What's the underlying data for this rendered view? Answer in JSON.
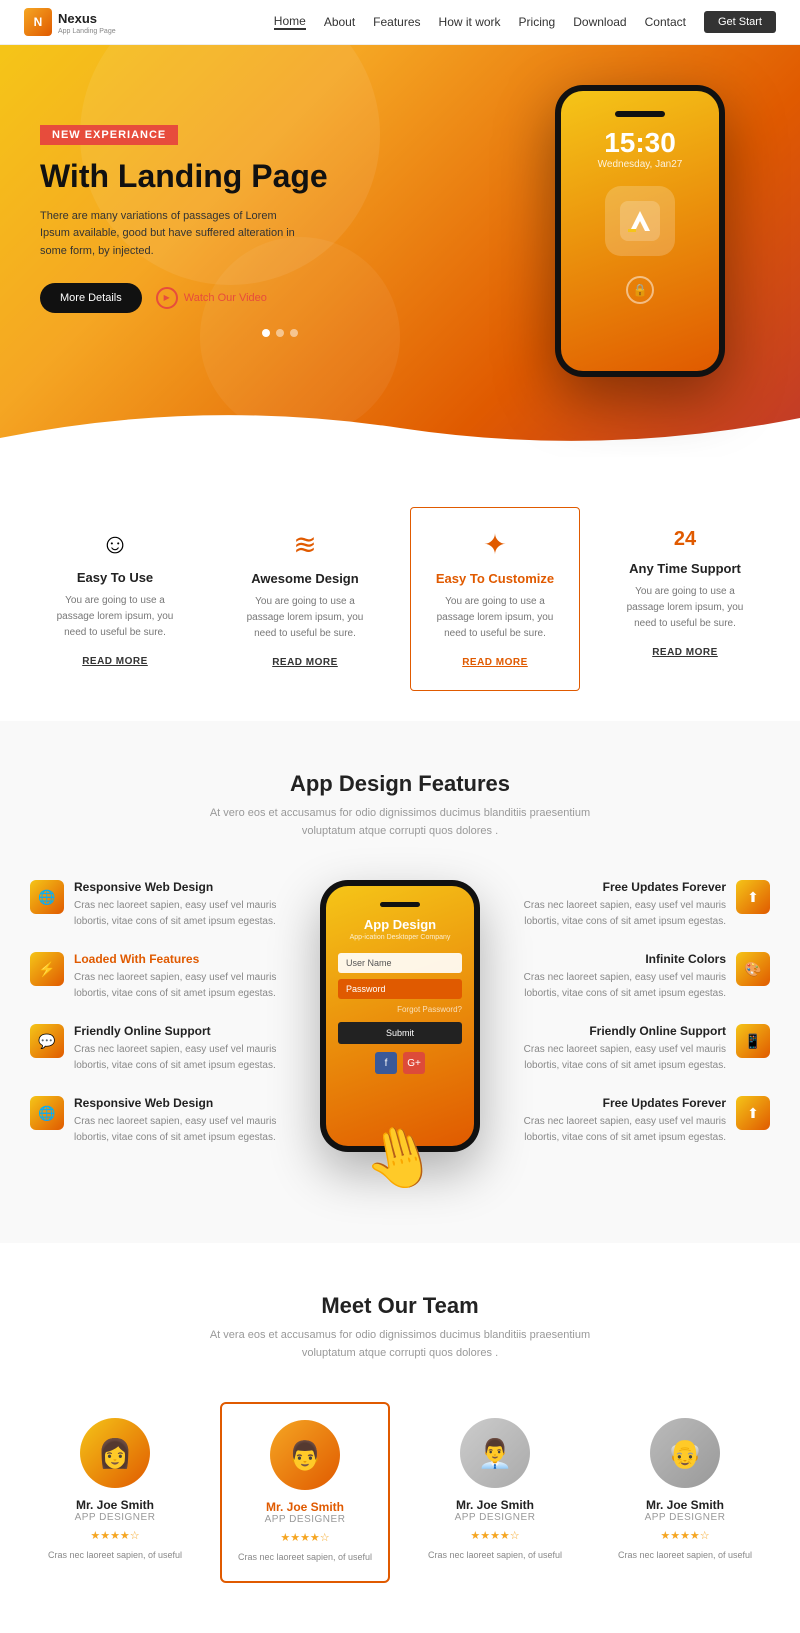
{
  "nav": {
    "logo": "Nexus",
    "logo_sub": "App Landing Page",
    "links": [
      "Home",
      "About",
      "Features",
      "How it work",
      "Pricing",
      "Download",
      "Contact"
    ],
    "active_link": "Home",
    "cta": "Get Start"
  },
  "hero": {
    "badge": "NEW EXPERIANCE",
    "title": "With Landing Page",
    "desc": "There are many variations of passages of Lorem Ipsum available, good but have suffered alteration in some form, by injected.",
    "btn_main": "More Details",
    "btn_video": "Watch Our Video",
    "phone_time": "15:30",
    "phone_date": "Wednesday, Jan27",
    "dots": [
      1,
      2,
      3
    ]
  },
  "features": {
    "title_section": "",
    "items": [
      {
        "icon": "☺",
        "title": "Easy To Use",
        "desc": "You are going to use a passage lorem ipsum, you need to useful be sure.",
        "link": "READ MORE",
        "active": false
      },
      {
        "icon": "≋",
        "title": "Awesome Design",
        "desc": "You are going to use a passage lorem ipsum, you need to useful be sure.",
        "link": "READ MORE",
        "active": false
      },
      {
        "icon": "✦",
        "title": "Easy To Customize",
        "desc": "You are going to use a passage lorem ipsum, you need to useful be sure.",
        "link": "READ MORE",
        "active": true
      },
      {
        "icon": "24",
        "title": "Any Time Support",
        "desc": "You are going to use a passage lorem ipsum, you need to useful be sure.",
        "link": "READ MORE",
        "active": false
      }
    ]
  },
  "app_features": {
    "title": "App Design Features",
    "subtitle": "At vero eos et accusamus for odio dignissimos ducimus blanditiis praesentium voluptatum atque corrupti quos dolores .",
    "left_items": [
      {
        "icon": "🌐",
        "title": "Responsive Web Design",
        "title_class": "",
        "desc": "Cras nec laoreet sapien, easy usef vel mauris lobortis, vitae cons of sit amet ipsum egestas."
      },
      {
        "icon": "⚡",
        "title": "Loaded With Features",
        "title_class": "orange",
        "desc": "Cras nec laoreet sapien, easy usef vel mauris lobortis, vitae cons of sit amet ipsum egestas."
      },
      {
        "icon": "💬",
        "title": "Friendly Online Support",
        "title_class": "",
        "desc": "Cras nec laoreet sapien, easy usef vel mauris lobortis, vitae cons of sit amet ipsum egestas."
      },
      {
        "icon": "🌐",
        "title": "Responsive Web Design",
        "title_class": "",
        "desc": "Cras nec laoreet sapien, easy usef vel mauris lobortis, vitae cons of sit amet ipsum egestas."
      }
    ],
    "right_items": [
      {
        "icon": "⬆",
        "title": "Free Updates Forever",
        "desc": "Cras nec laoreet sapien, easy usef vel mauris lobortis, vitae cons of sit amet ipsum egestas."
      },
      {
        "icon": "🎨",
        "title": "Infinite Colors",
        "desc": "Cras nec laoreet sapien, easy usef vel mauris lobortis, vitae cons of sit amet ipsum egestas."
      },
      {
        "icon": "💬",
        "title": "Friendly Online Support",
        "desc": "Cras nec laoreet sapien, easy usef vel mauris lobortis, vitae cons of sit amet ipsum egestas."
      },
      {
        "icon": "⬆",
        "title": "Free Updates Forever",
        "desc": "Cras nec laoreet sapien, easy usef vel mauris lobortis, vitae cons of sit amet ipsum egestas."
      }
    ],
    "phone": {
      "title": "App Design",
      "sub": "App-ication Desktoper Company",
      "field1": "User Name",
      "field2": "Password",
      "forgot": "Forgot Password?",
      "btn": "Submit"
    }
  },
  "team": {
    "title": "Meet Our Team",
    "subtitle": "At vera eos et accusamus for odio dignissimos ducimus blanditiis praesentium voluptatum atque corrupti quos dolores .",
    "members": [
      {
        "name": "Mr. Joe Smith",
        "role": "APP DESIGNER",
        "stars": "★★★★☆",
        "desc": "Cras nec laoreet sapien, of useful",
        "active": false
      },
      {
        "name": "Mr. Joe Smith",
        "role": "APP DESIGNER",
        "stars": "★★★★☆",
        "desc": "Cras nec laoreet sapien, of useful",
        "active": true
      },
      {
        "name": "Mr. Joe Smith",
        "role": "APP DESIGNER",
        "stars": "★★★★☆",
        "desc": "Cras nec laoreet sapien, of useful",
        "active": false
      },
      {
        "name": "Mr. Joe Smith",
        "role": "APP DESIGNER",
        "stars": "★★★★☆",
        "desc": "Cras nec laoreet sapien, of useful",
        "active": false
      }
    ]
  }
}
